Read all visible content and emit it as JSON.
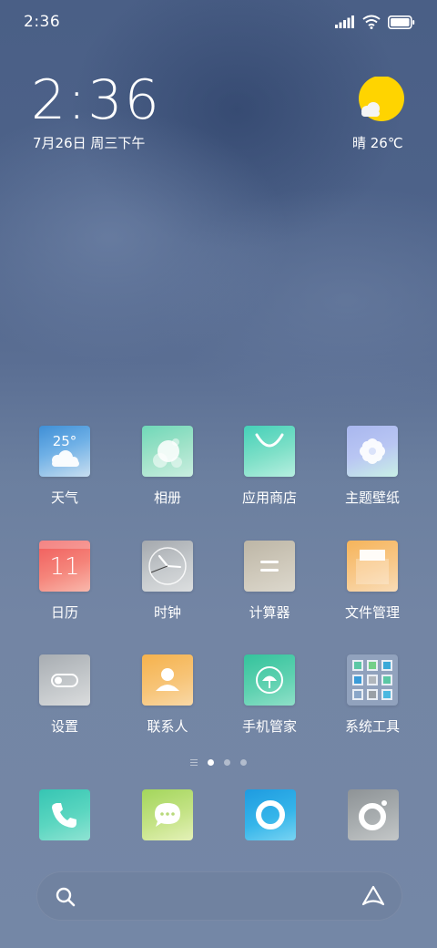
{
  "status_bar": {
    "time": "2:36"
  },
  "clock_widget": {
    "time": "2:36",
    "date": "7月26日 周三下午"
  },
  "weather_widget": {
    "text": "晴 26℃"
  },
  "apps": [
    {
      "label": "天气",
      "icon": "weather-icon",
      "badge": "25°"
    },
    {
      "label": "相册",
      "icon": "gallery-icon"
    },
    {
      "label": "应用商店",
      "icon": "app-store-icon"
    },
    {
      "label": "主题壁纸",
      "icon": "themes-icon"
    },
    {
      "label": "日历",
      "icon": "calendar-icon",
      "badge": "11"
    },
    {
      "label": "时钟",
      "icon": "clock-icon"
    },
    {
      "label": "计算器",
      "icon": "calculator-icon"
    },
    {
      "label": "文件管理",
      "icon": "file-manager-icon"
    },
    {
      "label": "设置",
      "icon": "settings-icon"
    },
    {
      "label": "联系人",
      "icon": "contacts-icon"
    },
    {
      "label": "手机管家",
      "icon": "security-icon"
    },
    {
      "label": "系统工具",
      "icon": "system-tools-folder-icon"
    }
  ],
  "page_indicator": {
    "pages": 3,
    "active": 1
  },
  "dock": [
    "phone-icon",
    "messages-icon",
    "browser-icon",
    "camera-icon"
  ],
  "colors": {
    "sun": "#ffd400",
    "wallpaper_top": "#4a5f86",
    "wallpaper_bottom": "#7487a6"
  }
}
